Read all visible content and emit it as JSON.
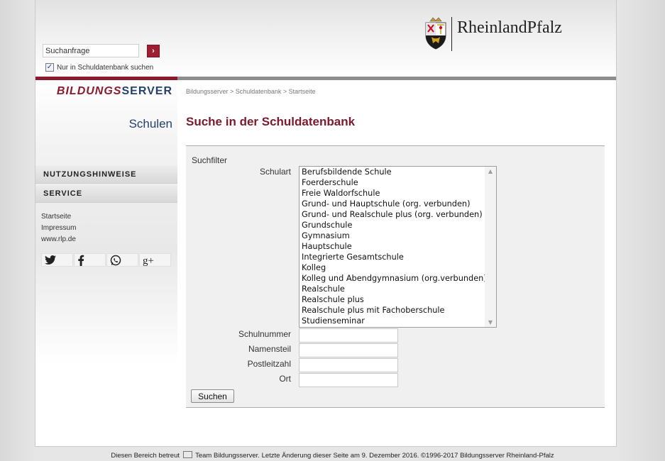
{
  "header": {
    "search": {
      "placeholder": "Suchanfrage",
      "value": "Suchanfrage"
    },
    "search_button_icon": "arrow-right-icon",
    "checkbox": {
      "checked": true,
      "label": "Nur in Schuldatenbank suchen"
    },
    "logo_text": "RheinlandPfalz"
  },
  "sidebar": {
    "brand": {
      "part1": "BILDUNGS",
      "part2": "SERVER"
    },
    "section_title": "Schulen",
    "nav": [
      {
        "label": "NUTZUNGSHINWEISE"
      },
      {
        "label": "SERVICE"
      }
    ],
    "links": [
      {
        "label": "Startseite"
      },
      {
        "label": "Impressum"
      },
      {
        "label": "www.rlp.de"
      }
    ],
    "social": [
      {
        "icon": "twitter-icon",
        "glyph": "t"
      },
      {
        "icon": "facebook-icon",
        "glyph": "f"
      },
      {
        "icon": "whatsapp-icon",
        "glyph": "✆"
      },
      {
        "icon": "google-plus-icon",
        "glyph": "g+"
      }
    ]
  },
  "main": {
    "breadcrumb": "Bildungsserver > Schuldatenbank > Startseite",
    "title": "Suche in der Schuldatenbank",
    "filter": {
      "legend": "Suchfilter",
      "schulart_label": "Schulart",
      "schulart_options": [
        "Berufsbildende Schule",
        "Foerderschule",
        "Freie Waldorfschule",
        "Grund- und Hauptschule (org. verbunden)",
        "Grund- und Realschule plus (org. verbunden)",
        "Grundschule",
        "Gymnasium",
        "Hauptschule",
        "Integrierte Gesamtschule",
        "Kolleg",
        "Kolleg und Abendgymnasium (org.verbunden)",
        "Realschule",
        "Realschule plus",
        "Realschule plus mit Fachoberschule",
        "Studienseminar"
      ],
      "fields": [
        {
          "label": "Schulnummer",
          "value": ""
        },
        {
          "label": "Namensteil",
          "value": ""
        },
        {
          "label": "Postleitzahl",
          "value": ""
        },
        {
          "label": "Ort",
          "value": ""
        }
      ],
      "submit_label": "Suchen"
    }
  },
  "footer": {
    "before": "Diesen Bereich betreut ",
    "mail_icon": "mail-icon",
    "after": " Team Bildungsserver. Letzte Änderung dieser Seite am  9. Dezember 2016. ©1996-2017 Bildungsserver Rheinland-Pfalz"
  },
  "colors": {
    "accent_red": "#8b1a2c",
    "title_red": "#7a1a2b",
    "brand_blue": "#24406e"
  }
}
